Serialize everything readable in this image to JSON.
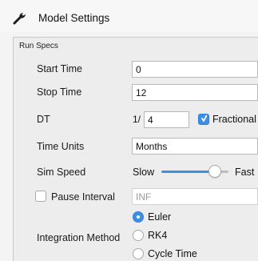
{
  "header": {
    "title": "Model Settings",
    "icon": "wrench-icon"
  },
  "run_specs": {
    "title": "Run Specs",
    "start_time": {
      "label": "Start Time",
      "value": "0"
    },
    "stop_time": {
      "label": "Stop Time",
      "value": "12"
    },
    "dt": {
      "label": "DT",
      "prefix": "1/",
      "value": "4",
      "fractional_label": "Fractional",
      "fractional_checked": true
    },
    "time_units": {
      "label": "Time Units",
      "value": "Months"
    },
    "sim_speed": {
      "label": "Sim Speed",
      "slow_label": "Slow",
      "fast_label": "Fast",
      "level": 0.8
    },
    "pause_interval": {
      "label": "Pause Interval",
      "checked": false,
      "value": "INF"
    },
    "integration_method": {
      "label": "Integration Method",
      "options": [
        "Euler",
        "RK4",
        "Cycle Time"
      ],
      "selected": "Euler"
    }
  },
  "colors": {
    "accent": "#3d8fe6",
    "panel": "#ededed",
    "background": "#f4f4f4"
  }
}
